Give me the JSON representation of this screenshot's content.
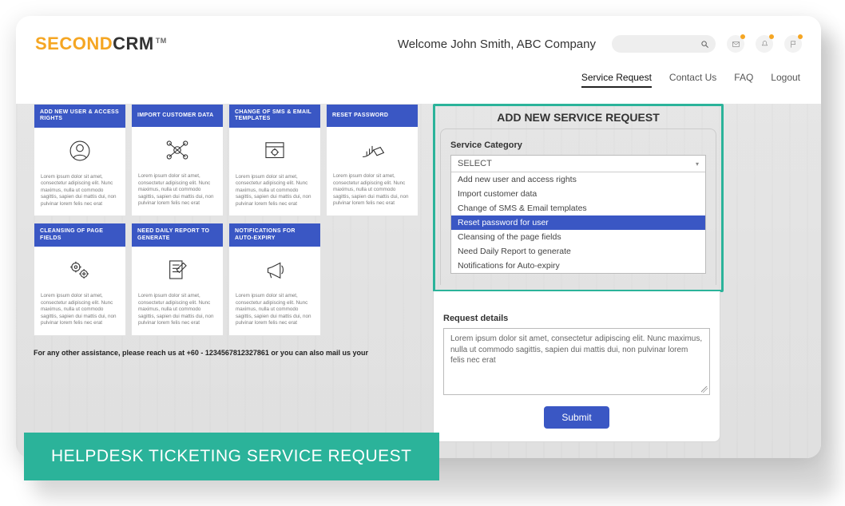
{
  "logo": {
    "part1": "SECOND",
    "part2": "CRM",
    "tm": "TM"
  },
  "welcome": "Welcome John Smith, ABC Company",
  "nav": {
    "items": [
      "Service Request",
      "Contact Us",
      "FAQ",
      "Logout"
    ],
    "active_index": 0
  },
  "lorem": "Lorem ipsum dolor sit amet, consectetur adipiscing elit. Nunc maximus, nulla ut commodo sagittis, sapien dui mattis dui, non pulvinar lorem felis nec erat",
  "cards": [
    {
      "title": "ADD NEW USER & ACCESS RIGHTS",
      "icon": "user-icon"
    },
    {
      "title": "IMPORT CUSTOMER DATA",
      "icon": "network-icon"
    },
    {
      "title": "CHANGE OF SMS & EMAIL TEMPLATES",
      "icon": "template-icon"
    },
    {
      "title": "RESET PASSWORD",
      "icon": "growth-icon"
    },
    {
      "title": "CLEANSING OF PAGE FIELDS",
      "icon": "gears-icon"
    },
    {
      "title": "NEED DAILY REPORT TO GENERATE",
      "icon": "report-icon"
    },
    {
      "title": "NOTIFICATIONS FOR AUTO-EXPIRY",
      "icon": "megaphone-icon"
    }
  ],
  "assist_note": "For any other assistance, please reach us at +60 - 1234567812327861 or you can also mail us your",
  "panel": {
    "title": "ADD NEW SERVICE REQUEST",
    "category_label": "Service Category",
    "select_placeholder": "SELECT",
    "options": [
      "Add new user and access rights",
      "Import customer data",
      "Change of SMS & Email templates",
      "Reset password for user",
      "Cleansing of the page fields",
      "Need Daily Report to generate",
      "Notifications for Auto-expiry"
    ],
    "selected_index": 3,
    "details_label": "Request details",
    "details_value": "Lorem ipsum dolor sit amet, consectetur adipiscing elit. Nunc maximus, nulla ut commodo sagittis, sapien dui mattis dui, non pulvinar lorem felis nec erat",
    "submit_label": "Submit"
  },
  "banner": "HELPDESK TICKETING SERVICE REQUEST"
}
